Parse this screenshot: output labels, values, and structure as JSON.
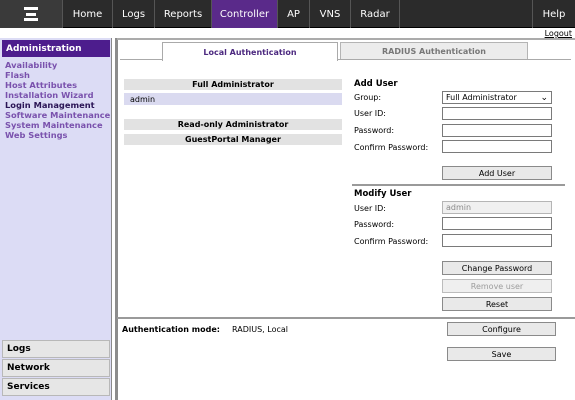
{
  "nav": {
    "items": [
      {
        "label": "Home"
      },
      {
        "label": "Logs"
      },
      {
        "label": "Reports"
      },
      {
        "label": "Controller"
      },
      {
        "label": "AP"
      },
      {
        "label": "VNS"
      },
      {
        "label": "Radar"
      },
      {
        "label": "Help"
      }
    ],
    "active_index": 3,
    "active_color": "#5a2a8a",
    "logout": "Logout"
  },
  "sidebar": {
    "header": "Administration",
    "links": [
      {
        "label": "Availability"
      },
      {
        "label": "Flash"
      },
      {
        "label": "Host Attributes"
      },
      {
        "label": "Installation Wizard"
      },
      {
        "label": "Login Management"
      },
      {
        "label": "Software Maintenance"
      },
      {
        "label": "System Maintenance"
      },
      {
        "label": "Web Settings"
      }
    ],
    "active_link_index": 4,
    "sections": [
      {
        "label": "Logs"
      },
      {
        "label": "Network"
      },
      {
        "label": "Services"
      }
    ]
  },
  "tabs": [
    {
      "label": "Local Authentication",
      "active": true
    },
    {
      "label": "RADIUS Authentication",
      "active": false
    }
  ],
  "groups": {
    "full_admin": {
      "header": "Full Administrator",
      "users": [
        "admin"
      ]
    },
    "readonly_admin": {
      "header": "Read-only Administrator"
    },
    "guestportal": {
      "header": "GuestPortal Manager"
    }
  },
  "add_user": {
    "title": "Add User",
    "group_label": "Group:",
    "group_value": "Full Administrator",
    "userid_label": "User ID:",
    "password_label": "Password:",
    "confirm_label": "Confirm Password:",
    "add_button": "Add User"
  },
  "modify_user": {
    "title": "Modify User",
    "userid_label": "User ID:",
    "userid_value": "admin",
    "password_label": "Password:",
    "confirm_label": "Confirm Password:",
    "change_button": "Change Password",
    "remove_button": "Remove user",
    "reset_button": "Reset"
  },
  "auth": {
    "label": "Authentication mode:",
    "value": "RADIUS, Local",
    "configure_button": "Configure",
    "save_button": "Save"
  }
}
